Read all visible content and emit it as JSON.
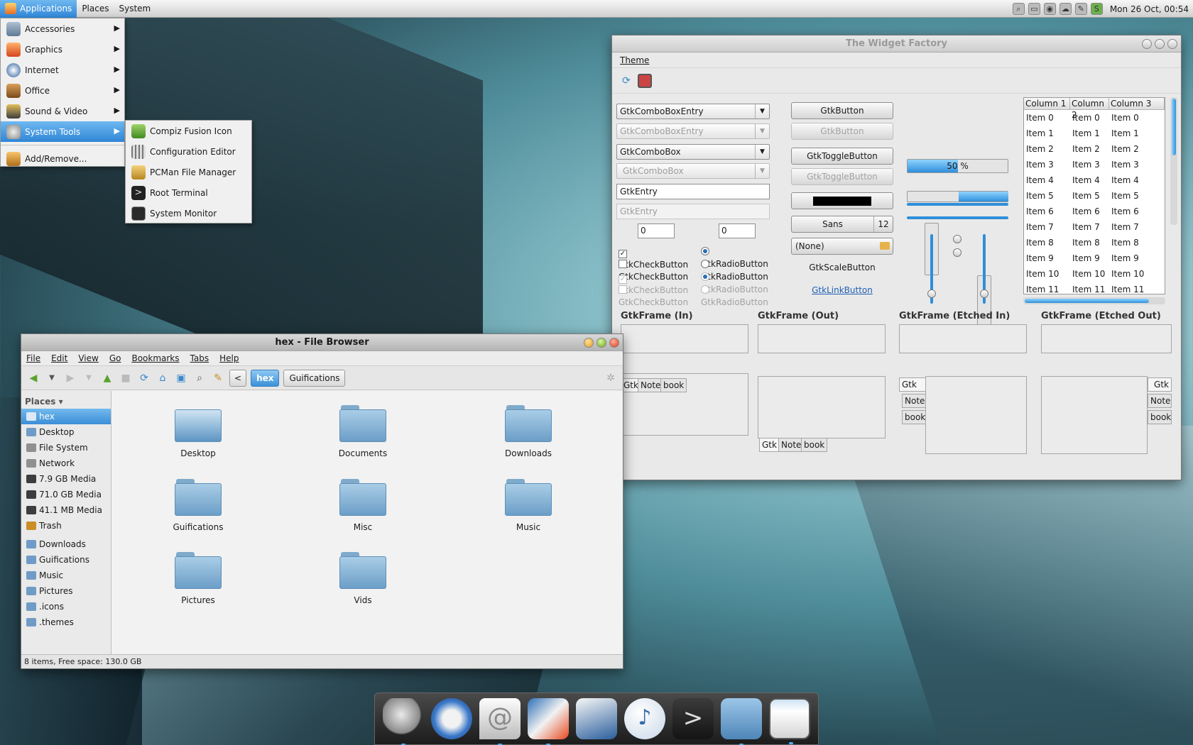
{
  "panel": {
    "menus": [
      "Applications",
      "Places",
      "System"
    ],
    "clock": "Mon 26 Oct, 00:54",
    "tray_icons": [
      "search-icon",
      "screenshot-icon",
      "network-icon",
      "weather-icon",
      "pen-icon",
      "compiz-icon"
    ]
  },
  "apps_menu": {
    "items": [
      {
        "label": "Accessories",
        "icon": "accessories-icon"
      },
      {
        "label": "Graphics",
        "icon": "graphics-icon"
      },
      {
        "label": "Internet",
        "icon": "internet-icon"
      },
      {
        "label": "Office",
        "icon": "office-icon"
      },
      {
        "label": "Sound & Video",
        "icon": "sound-video-icon"
      },
      {
        "label": "System Tools",
        "icon": "system-tools-icon"
      }
    ],
    "add_remove": "Add/Remove..."
  },
  "system_tools_menu": {
    "items": [
      "Compiz Fusion Icon",
      "Configuration Editor",
      "PCMan File Manager",
      "Root Terminal",
      "System Monitor"
    ]
  },
  "file_browser": {
    "title": "hex - File Browser",
    "menus": [
      "File",
      "Edit",
      "View",
      "Go",
      "Bookmarks",
      "Tabs",
      "Help"
    ],
    "breadcrumbs": [
      "hex",
      "Guifications"
    ],
    "places_header": "Places",
    "places": [
      "hex",
      "Desktop",
      "File System",
      "Network",
      "7.9 GB Media",
      "71.0 GB Media",
      "41.1 MB Media",
      "Trash"
    ],
    "bookmarks": [
      "Downloads",
      "Guifications",
      "Music",
      "Pictures",
      ".icons",
      ".themes"
    ],
    "files": [
      "Desktop",
      "Documents",
      "Downloads",
      "Guifications",
      "Misc",
      "Music",
      "Pictures",
      "Vids"
    ],
    "status": "8 items, Free space: 130.0 GB"
  },
  "widget_factory": {
    "title": "The Widget Factory",
    "menu": "Theme",
    "combo_entry": "GtkComboBoxEntry",
    "combo_entry_disabled": "GtkComboBoxEntry",
    "combo": "GtkComboBox",
    "combo_disabled": "GtkComboBox",
    "entry": "GtkEntry",
    "entry_disabled": "GtkEntry",
    "spin1": "0",
    "spin2": "0",
    "checks": [
      "GtkCheckButton",
      "GtkCheckButton",
      "GtkCheckButton",
      "GtkCheckButton"
    ],
    "radios": [
      "GtkRadioButton",
      "GtkRadioButton",
      "GtkRadioButton",
      "GtkRadioButton"
    ],
    "button": "GtkButton",
    "button_disabled": "GtkButton",
    "toggle": "GtkToggleButton",
    "toggle_disabled": "GtkToggleButton",
    "font_name": "Sans",
    "font_size": "12",
    "file_chooser": "(None)",
    "scale_button": "GtkScaleButton",
    "link_button": "GtkLinkButton",
    "progress_label": "50 %",
    "progress_value": 0.5,
    "columns": [
      "Column 1",
      "Column 2",
      "Column 3"
    ],
    "rows": [
      [
        "Item 0",
        "Item 0",
        "Item 0"
      ],
      [
        "Item 1",
        "Item 1",
        "Item 1"
      ],
      [
        "Item 2",
        "Item 2",
        "Item 2"
      ],
      [
        "Item 3",
        "Item 3",
        "Item 3"
      ],
      [
        "Item 4",
        "Item 4",
        "Item 4"
      ],
      [
        "Item 5",
        "Item 5",
        "Item 5"
      ],
      [
        "Item 6",
        "Item 6",
        "Item 6"
      ],
      [
        "Item 7",
        "Item 7",
        "Item 7"
      ],
      [
        "Item 8",
        "Item 8",
        "Item 8"
      ],
      [
        "Item 9",
        "Item 9",
        "Item 9"
      ],
      [
        "Item 10",
        "Item 10",
        "Item 10"
      ],
      [
        "Item 11",
        "Item 11",
        "Item 11"
      ]
    ],
    "frames": [
      "GtkFrame (In)",
      "GtkFrame (Out)",
      "GtkFrame (Etched In)",
      "GtkFrame (Etched Out)"
    ],
    "notebook_tabs": [
      "Gtk",
      "Note",
      "book"
    ]
  },
  "dock": {
    "items": [
      "spotlight-icon",
      "safari-icon",
      "mail-icon",
      "draw-icon",
      "inkscape-icon",
      "twitter-icon",
      "terminal-icon",
      "home-folder-icon",
      "window-icon"
    ]
  }
}
